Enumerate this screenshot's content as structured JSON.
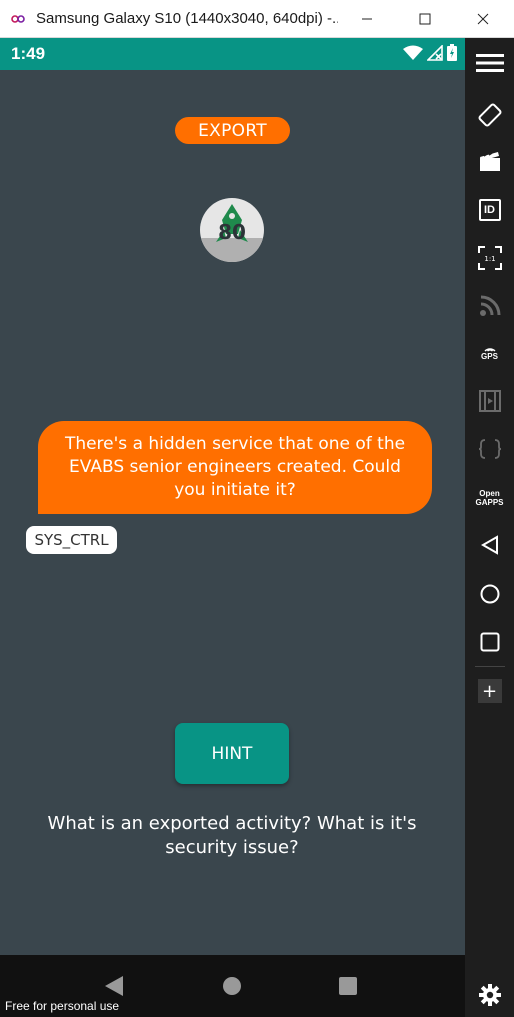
{
  "window": {
    "title": "Samsung Galaxy S10 (1440x3040, 640dpi) -...",
    "buttons": [
      "minimize",
      "maximize",
      "close"
    ]
  },
  "status_bar": {
    "time": "1:49",
    "icons": [
      "wifi-icon",
      "signal-off-icon",
      "battery-icon"
    ],
    "color": "#089485"
  },
  "screen": {
    "export_label": "EXPORT",
    "logo_number": "80",
    "message": "There's a hidden service that one of the EVABS senior engineers created. Could you initiate it?",
    "chip_label": "SYS_CTRL",
    "hint_label": "HINT",
    "question": "What is an exported activity? What is it's security issue?",
    "accent": "#ff6f00",
    "background": "#3a464d"
  },
  "nav_bar": {
    "icons": [
      "back-icon",
      "home-icon",
      "recents-icon"
    ]
  },
  "watermark": "Free for personal use",
  "side_toolbar": {
    "items": [
      "menu-icon",
      "rotate-icon",
      "clapper-icon",
      "id-icon",
      "fit-1to1-icon",
      "rss-icon",
      "gps-icon",
      "film-icon",
      "braces-icon",
      "opengapps-icon",
      "back-icon",
      "home-icon",
      "overview-icon",
      "plus-icon",
      "settings-icon"
    ],
    "id_label": "ID",
    "ratio_label": "1:1",
    "gps_label": "GPS",
    "opengapps_label": "Open GAPPS",
    "plus_label": "+"
  }
}
